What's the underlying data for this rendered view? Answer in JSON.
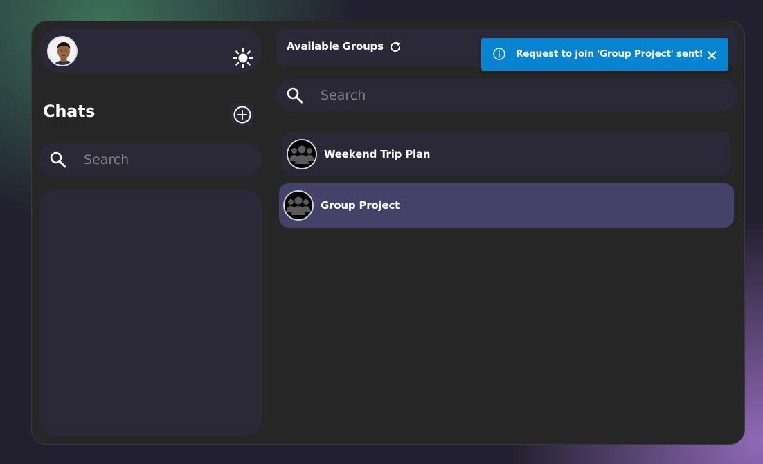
{
  "sidebar": {
    "profile": {
      "avatar_icon": "user-avatar",
      "theme_icon": "sun-icon"
    },
    "title": "Chats",
    "add_icon": "plus-circle-icon",
    "search": {
      "placeholder": "Search",
      "value": ""
    }
  },
  "main": {
    "header": {
      "title": "Available Groups",
      "refresh_icon": "refresh-icon"
    },
    "search": {
      "placeholder": "Search",
      "value": ""
    },
    "groups": [
      {
        "name": "Weekend Trip Plan",
        "icon": "group-icon"
      },
      {
        "name": "Group Project",
        "icon": "group-icon",
        "selected": true
      }
    ]
  },
  "toast": {
    "icon": "info-icon",
    "message": "Request to join 'Group Project' sent!",
    "color": "#0684d1"
  },
  "colors": {
    "panel": "#262626",
    "card": "#2b2938",
    "selected": "#45426a"
  }
}
